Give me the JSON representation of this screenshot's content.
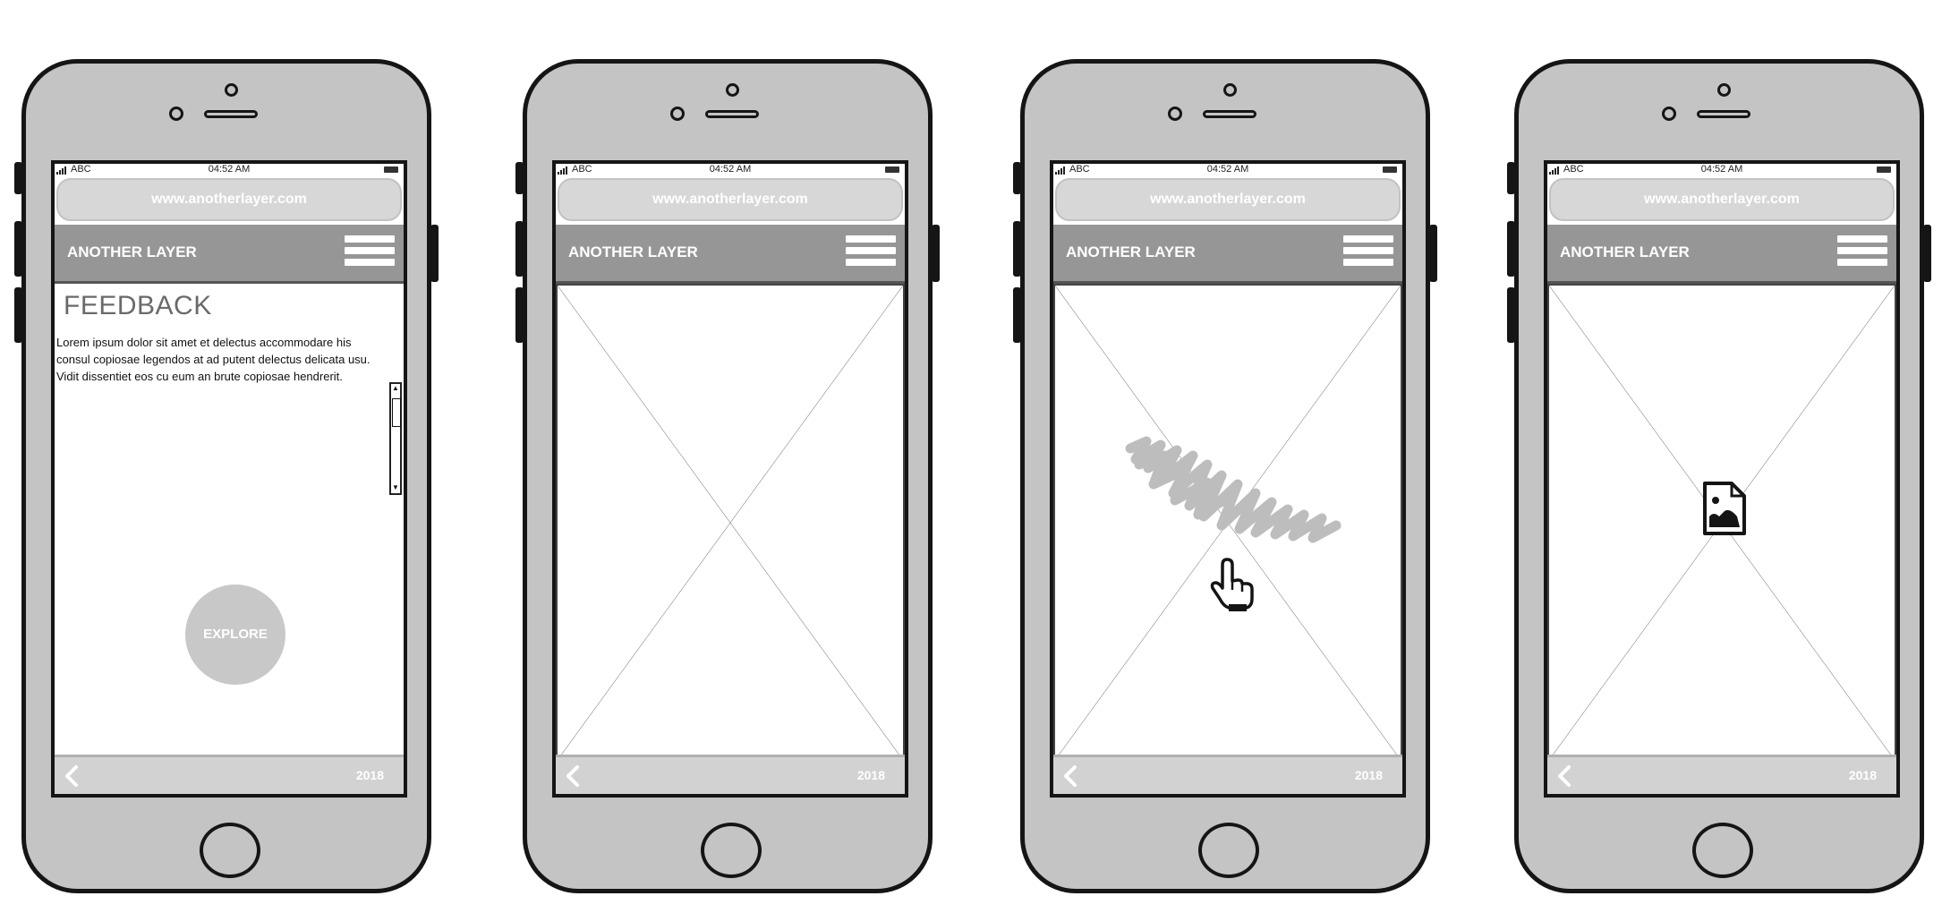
{
  "status_bar": {
    "carrier": "ABC",
    "time": "04:52 AM"
  },
  "url": "www.anotherlayer.com",
  "brand": "ANOTHER LAYER",
  "footer_year": "2018",
  "feedback_screen": {
    "heading": "FEEDBACK",
    "body": "Lorem ipsum dolor sit amet et delectus accommodare his consul copiosae legendos at ad putent delectus delicata usu. Vidit dissentiet eos cu eum an brute copiosae hendrerit.",
    "explore_label": "EXPLORE"
  },
  "icons": {
    "menu": "hamburger-menu-icon",
    "back": "back-chevron-icon",
    "pointer": "hand-pointer-icon",
    "image": "image-file-icon",
    "scribble": "scribble-highlight"
  },
  "colors": {
    "phone_body": "#c4c4c4",
    "outline": "#151515",
    "navbar": "#969696",
    "url_bar": "#d7d7d7",
    "footer": "#d2d2d2",
    "explore_button": "#c8c8c8",
    "heading": "#6a6a6a"
  }
}
